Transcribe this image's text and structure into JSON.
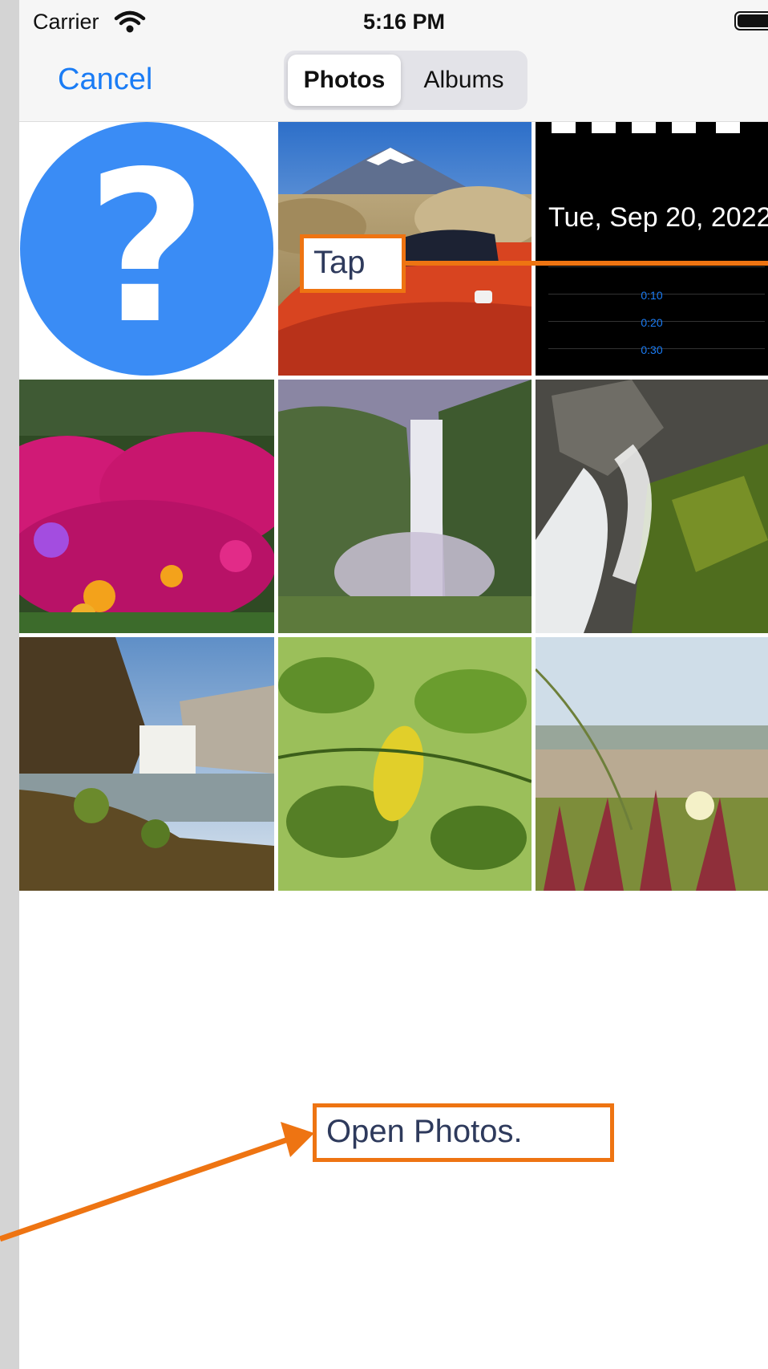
{
  "status_bar": {
    "carrier": "Carrier",
    "time": "5:16 PM"
  },
  "nav": {
    "cancel_label": "Cancel",
    "segments": [
      {
        "label": "Photos",
        "selected": true
      },
      {
        "label": "Albums",
        "selected": false
      }
    ]
  },
  "photos": {
    "tiles": [
      {
        "name": "question-mark-image",
        "glyph": "?"
      },
      {
        "name": "mount-fuji-red-car-photo"
      },
      {
        "name": "stopwatch-screenshot",
        "date_text": "Tue, Sep 20, 2022",
        "laps": [
          "0:10",
          "0:20",
          "0:30"
        ]
      },
      {
        "name": "magenta-flowers-photo"
      },
      {
        "name": "waterfall-photo"
      },
      {
        "name": "mossy-rocks-waterfall-photo"
      },
      {
        "name": "coastal-waterfall-photo"
      },
      {
        "name": "green-leaves-photo"
      },
      {
        "name": "beach-plants-photo"
      }
    ]
  },
  "annotations": {
    "tap_label": "Tap",
    "open_photos_label": "Open Photos.",
    "accent_color": "#ee7412"
  },
  "colors": {
    "link_blue": "#1a7cf5",
    "question_blue": "#3a8cf5"
  }
}
